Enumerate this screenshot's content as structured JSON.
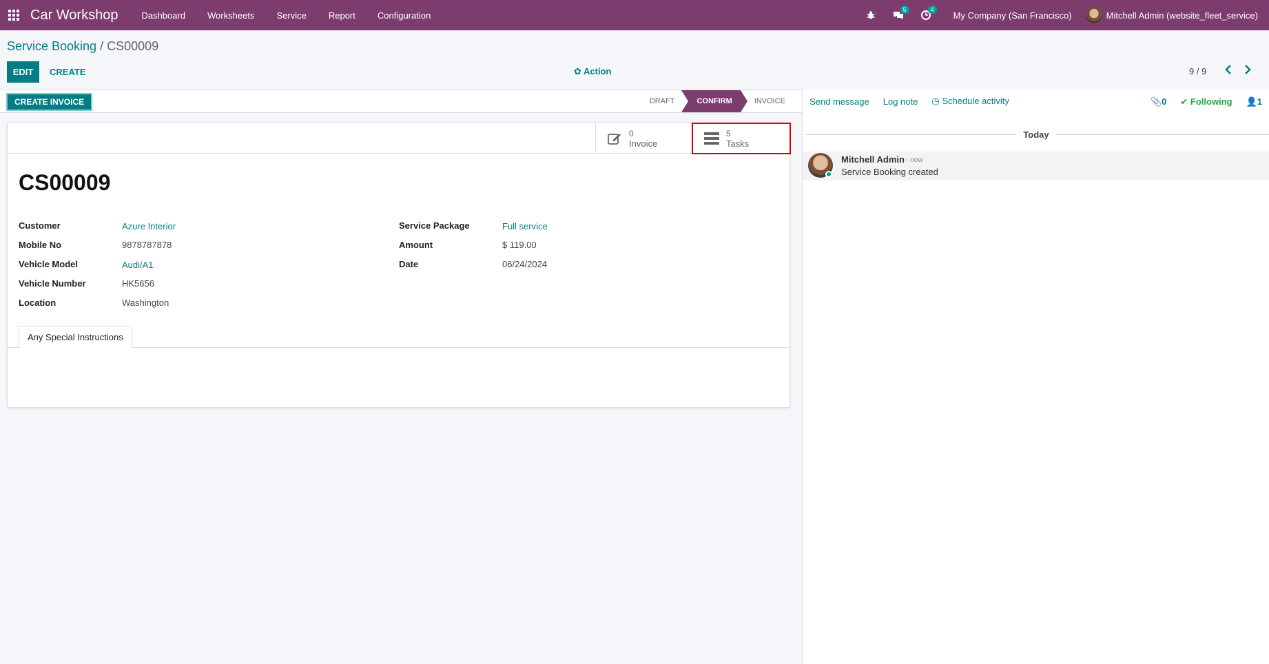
{
  "navbar": {
    "app_title": "Car Workshop",
    "menu": [
      "Dashboard",
      "Worksheets",
      "Service",
      "Report",
      "Configuration"
    ],
    "messages_badge": "5",
    "activities_badge": "4",
    "company": "My Company (San Francisco)",
    "user": "Mitchell Admin (website_fleet_service)"
  },
  "breadcrumb": {
    "parent": "Service Booking",
    "separator": " / ",
    "current": "CS00009"
  },
  "control": {
    "edit_label": "EDIT",
    "create_label": "CREATE",
    "action_label": "✿ Action",
    "pager": "9 / 9"
  },
  "statusbar": {
    "create_invoice_label": "CREATE INVOICE",
    "stages": [
      "DRAFT",
      "CONFIRM",
      "INVOICE"
    ],
    "active_stage": "CONFIRM"
  },
  "smart_buttons": {
    "invoice": {
      "value": "0",
      "label": "Invoice"
    },
    "tasks": {
      "value": "5",
      "label": "Tasks"
    }
  },
  "record": {
    "name": "CS00009",
    "left_fields": [
      {
        "label": "Customer",
        "value": "Azure Interior"
      },
      {
        "label": "Mobile No",
        "value": "9878787878"
      },
      {
        "label": "Vehicle Model",
        "value": "Audi/A1"
      },
      {
        "label": "Vehicle Number",
        "value": "HK5656"
      },
      {
        "label": "Location",
        "value": "Washington"
      }
    ],
    "right_fields": [
      {
        "label": "Service Package",
        "value": "Full service"
      },
      {
        "label": "Amount",
        "value": "$ 119.00"
      },
      {
        "label": "Date",
        "value": "06/24/2024"
      }
    ],
    "tab_label": "Any Special Instructions"
  },
  "chatter": {
    "send_message": "Send message",
    "log_note": "Log note",
    "schedule_activity": "Schedule activity",
    "attachments": "0",
    "following": "Following",
    "followers": "1",
    "date_separator": "Today",
    "message": {
      "author": "Mitchell Admin",
      "time": "- now",
      "body": "Service Booking created"
    }
  }
}
